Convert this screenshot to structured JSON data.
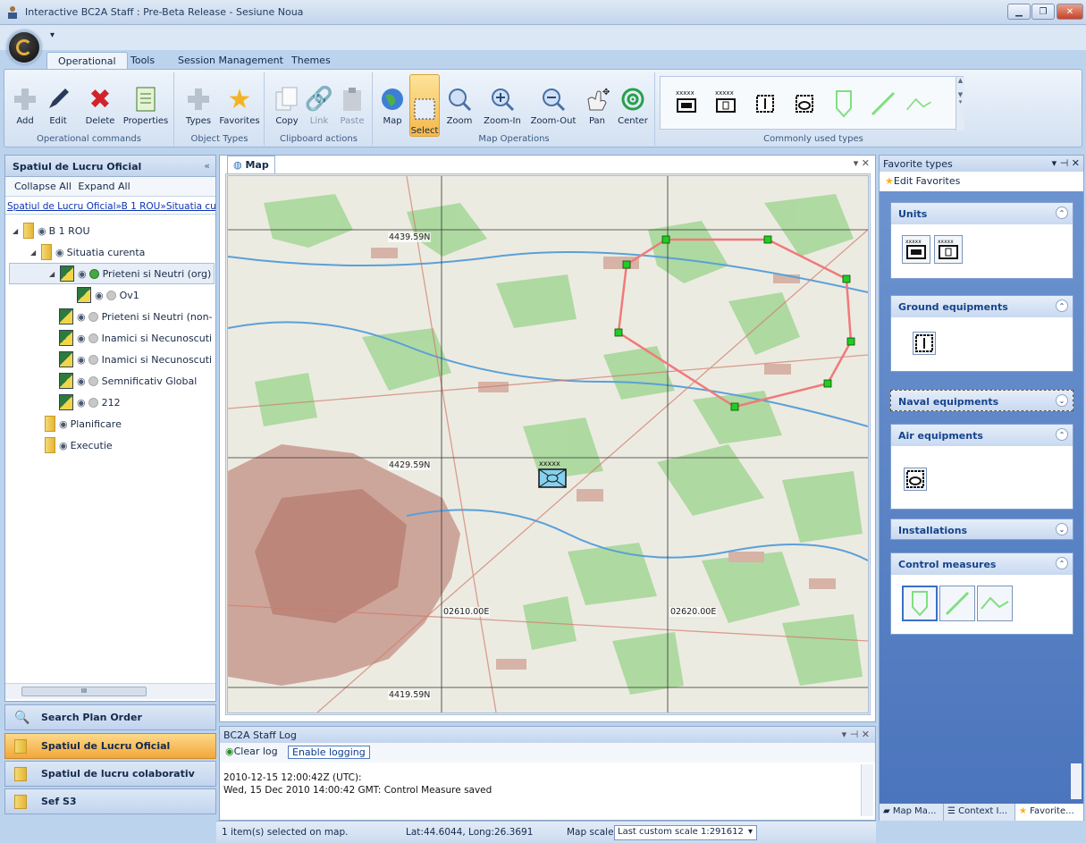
{
  "window": {
    "title": "Interactive BC2A Staff : Pre-Beta Release - Sesiune Noua"
  },
  "qat_arrow": "▾",
  "tabs": [
    "Operational",
    "Tools",
    "Session Management",
    "Themes"
  ],
  "ribbon": {
    "groups": [
      {
        "label": "Operational commands",
        "buttons": [
          "Add",
          "Edit",
          "Delete",
          "Properties"
        ]
      },
      {
        "label": "Object Types",
        "buttons": [
          "Types",
          "Favorites"
        ]
      },
      {
        "label": "Clipboard actions",
        "buttons": [
          "Copy",
          "Link",
          "Paste"
        ]
      },
      {
        "label": "Map Operations",
        "buttons": [
          "Map",
          "Select",
          "Zoom",
          "Zoom-In",
          "Zoom-Out",
          "Pan",
          "Center"
        ]
      },
      {
        "label": "Commonly used types"
      }
    ]
  },
  "left_panel": {
    "title": "Spatiul de Lucru Oficial",
    "collapse": "«",
    "toolbar": {
      "collapse_all": "Collapse All",
      "expand_all": "Expand All"
    },
    "breadcrumb": [
      "Spatiul de Lucru Oficial",
      "B 1 ROU",
      "Situatia cure"
    ],
    "breadcrumb_sep": "»",
    "tree": [
      {
        "label": "B 1 ROU",
        "level": 0
      },
      {
        "label": "Situatia curenta",
        "level": 1
      },
      {
        "label": "Prieteni si Neutri (org)",
        "level": 2
      },
      {
        "label": "Ov1",
        "level": 3
      },
      {
        "label": "Prieteni si Neutri (non-",
        "level": 2
      },
      {
        "label": "Inamici si Necunoscuti",
        "level": 2
      },
      {
        "label": "Inamici si Necunoscuti",
        "level": 2
      },
      {
        "label": "Semnificativ Global",
        "level": 2
      },
      {
        "label": "212",
        "level": 2
      },
      {
        "label": "Planificare",
        "level": 1
      },
      {
        "label": "Executie",
        "level": 1
      }
    ],
    "scroll_thumb": "III"
  },
  "nav": [
    "Search Plan Order",
    "Spatiul de Lucru Oficial",
    "Spatiul de lucru colaborativ",
    "Sef S3"
  ],
  "map": {
    "tab": "Map",
    "labels": {
      "lat_top": "4439.59N",
      "lat_mid": "4429.59N",
      "lat_bot": "4419.59N",
      "lon_1": "02610.00E",
      "lon_2": "02620.00E"
    }
  },
  "log": {
    "title": "BC2A Staff Log",
    "clear": "Clear log",
    "enable": "Enable logging",
    "lines": [
      "2010-12-15 12:00:42Z (UTC):",
      "Wed, 15 Dec 2010 14:00:42 GMT: Control Measure saved"
    ]
  },
  "status": {
    "selected": "1 item(s) selected on map.",
    "coords": "Lat:44.6044, Long:26.3691",
    "scale_label": "Map scale:",
    "scale_value": "Last custom scale 1:291612"
  },
  "right_panel": {
    "title": "Favorite types",
    "edit": "Edit Favorites",
    "groups": [
      "Units",
      "Ground equipments",
      "Naval equipments",
      "Air equipments",
      "Installations",
      "Control measures"
    ],
    "tabs": [
      "Map Ma...",
      "Context I...",
      "Favorite..."
    ]
  },
  "colors": {
    "accent": "#f5b84b",
    "polygon": "#f07a7a",
    "vertex": "#22cc22"
  }
}
